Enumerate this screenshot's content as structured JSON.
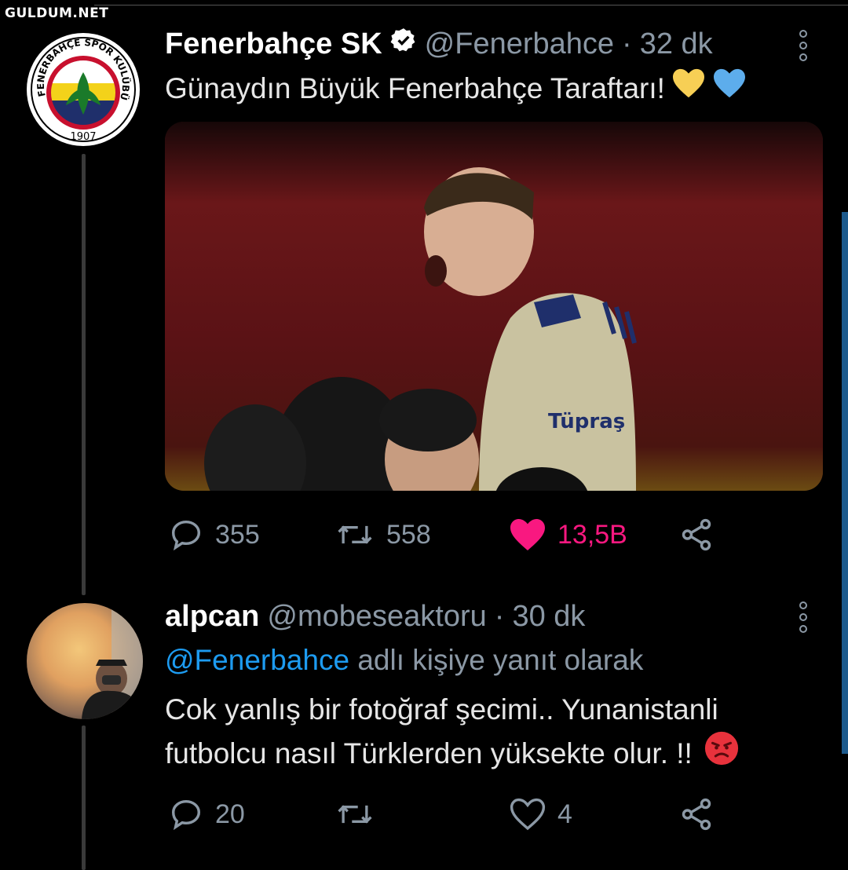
{
  "watermark": "GULDUM.NET",
  "tweet": {
    "name": "Fenerbahçe SK",
    "handle": "@Fenerbahce",
    "separator": "·",
    "time": "32 dk",
    "text": "Günaydın Büyük Fenerbahçe Taraftarı!",
    "emoji": [
      "yellow-heart",
      "blue-heart"
    ],
    "logo": {
      "top_text": "FENERBAHÇE SPOR KULÜBÜ",
      "year": "1907"
    },
    "photo_text": "Tüpraş",
    "stats": {
      "replies": "355",
      "retweets": "558",
      "likes": "13,5B"
    },
    "liked": true
  },
  "reply": {
    "name": "alpcan",
    "handle": "@mobeseaktoru",
    "separator": "·",
    "time": "30 dk",
    "reply_to_handle": "@Fenerbahce",
    "reply_to_suffix": "adlı kişiye yanıt olarak",
    "text_line1": "Cok yanlış bir fotoğraf şecimi.. Yunanistanli",
    "text_line2": "futbolcu nasıl Türklerden yüksekte olur. !!",
    "emoji": "angry-face",
    "stats": {
      "replies": "20",
      "retweets": "",
      "likes": "4"
    },
    "liked": false
  },
  "colors": {
    "background": "#000000",
    "secondary_text": "#8b98a5",
    "link": "#1d9bf0",
    "like": "#f91880",
    "verified": "#ffffff"
  },
  "icons": [
    "reply-icon",
    "retweet-icon",
    "like-icon",
    "share-icon",
    "more-icon",
    "verified-icon"
  ]
}
